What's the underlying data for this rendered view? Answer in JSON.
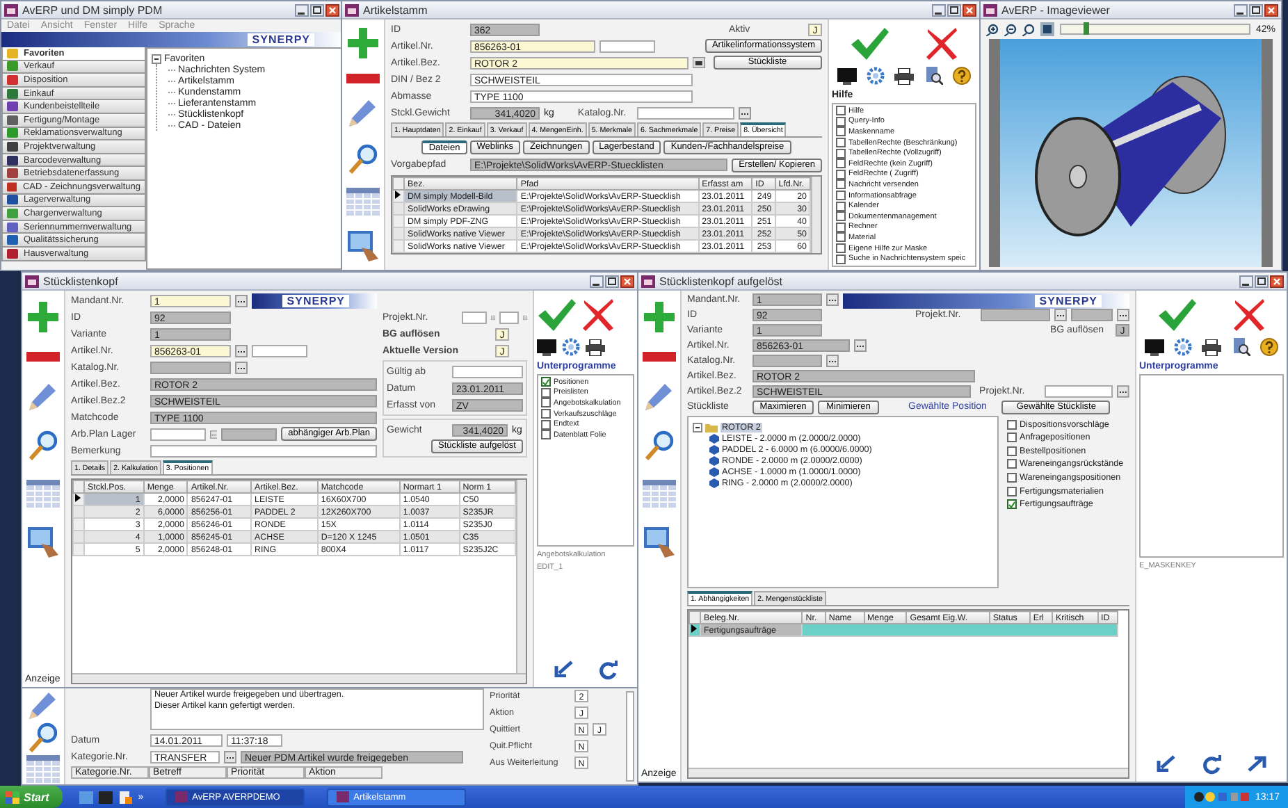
{
  "main_window": {
    "title": "AvERP und DM simply PDM",
    "menu": [
      "Datei",
      "Ansicht",
      "Fenster",
      "Hilfe",
      "Sprache"
    ],
    "logo": "SYNERPY",
    "nav_items": [
      {
        "label": "Favoriten",
        "selected": true
      },
      {
        "label": "Verkauf",
        "selected": false
      },
      {
        "label": "Disposition",
        "selected": false
      },
      {
        "label": "Einkauf",
        "selected": false
      },
      {
        "label": "Kundenbeistellteile",
        "selected": false
      },
      {
        "label": "Fertigung/Montage",
        "selected": false
      },
      {
        "label": "Reklamationsverwaltung",
        "selected": false
      },
      {
        "label": "Projektverwaltung",
        "selected": false
      },
      {
        "label": "Barcodeverwaltung",
        "selected": false
      },
      {
        "label": "Betriebsdatenerfassung",
        "selected": false
      },
      {
        "label": "CAD - Zeichnungsverwaltung",
        "selected": false
      },
      {
        "label": "Lagerverwaltung",
        "selected": false
      },
      {
        "label": "Chargenverwaltung",
        "selected": false
      },
      {
        "label": "Seriennummernverwaltung",
        "selected": false
      },
      {
        "label": "Qualitätssicherung",
        "selected": false
      },
      {
        "label": "Hausverwaltung",
        "selected": false
      }
    ],
    "tree": {
      "label": "Favoriten",
      "expanded": true,
      "children": [
        {
          "label": "Nachrichten System"
        },
        {
          "label": "Artikelstamm"
        },
        {
          "label": "Kundenstamm"
        },
        {
          "label": "Lieferantenstamm"
        },
        {
          "label": "Stücklistenkopf"
        },
        {
          "label": "CAD - Dateien"
        }
      ]
    }
  },
  "article_window": {
    "title": "Artikelstamm",
    "fields": [
      {
        "label": "ID",
        "value": "362",
        "kind": "readonly"
      },
      {
        "label": "Artikel.Nr.",
        "value": "856263-01",
        "kind": "required"
      },
      {
        "label": "Artikel.Bez.",
        "value": "ROTOR 2",
        "kind": "required"
      },
      {
        "label": "DIN / Bez 2",
        "value": "SCHWEISTEIL",
        "kind": "edit"
      },
      {
        "label": "Abmasse",
        "value": "TYPE 1100",
        "kind": "edit"
      },
      {
        "label": "Stckl.Gewicht",
        "value": "341,4020",
        "kind": "readonly"
      }
    ],
    "weight_unit": "kg",
    "catalog_label": "Katalog.Nr.",
    "active": {
      "label": "Aktiv",
      "value": "J"
    },
    "buttons": [
      "Artikelinformationssystem",
      "Stückliste"
    ],
    "tabs": [
      {
        "label": "1. Hauptdaten",
        "selected": false
      },
      {
        "label": "2. Einkauf",
        "selected": false
      },
      {
        "label": "3. Verkauf",
        "selected": false
      },
      {
        "label": "4. MengenEinh.",
        "selected": false
      },
      {
        "label": "5. Merkmale",
        "selected": false
      },
      {
        "label": "6. Sachmerkmale",
        "selected": false
      },
      {
        "label": "7. Preise",
        "selected": false
      },
      {
        "label": "8. Übersicht",
        "selected": true
      }
    ],
    "subtabs": [
      {
        "label": "Dateien",
        "selected": true
      },
      {
        "label": "Weblinks",
        "selected": false
      },
      {
        "label": "Zeichnungen",
        "selected": false
      },
      {
        "label": "Lagerbestand",
        "selected": false
      },
      {
        "label": "Kunden-/Fachhandelspreise",
        "selected": false
      }
    ],
    "default_path": {
      "label": "Vorgabepfad",
      "value": "E:\\Projekte\\SolidWorks\\AvERP-Stuecklisten",
      "button": "Erstellen/ Kopieren"
    },
    "table": {
      "columns": [
        "Bez.",
        "Pfad",
        "Erfasst am",
        "ID",
        "Lfd.Nr."
      ],
      "rows": [
        {
          "cells": [
            "DM simply Modell-Bild",
            "E:\\Projekte\\SolidWorks\\AvERP-Stuecklish",
            "23.01.2011",
            "249",
            "20"
          ],
          "selected": true
        },
        {
          "cells": [
            "SolidWorks eDrawing",
            "E:\\Projekte\\SolidWorks\\AvERP-Stuecklish",
            "23.01.2011",
            "250",
            "30"
          ],
          "selected": false
        },
        {
          "cells": [
            "DM simply PDF-ZNG",
            "E:\\Projekte\\SolidWorks\\AvERP-Stuecklish",
            "23.01.2011",
            "251",
            "40"
          ],
          "selected": false
        },
        {
          "cells": [
            "SolidWorks native Viewer",
            "E:\\Projekte\\SolidWorks\\AvERP-Stuecklish",
            "23.01.2011",
            "252",
            "50"
          ],
          "selected": false
        },
        {
          "cells": [
            "SolidWorks native Viewer",
            "E:\\Projekte\\SolidWorks\\AvERP-Stuecklish",
            "23.01.2011",
            "253",
            "60"
          ],
          "selected": false
        }
      ]
    },
    "help": {
      "title": "Hilfe",
      "items": [
        {
          "label": "Hilfe",
          "checked": false
        },
        {
          "label": "Query-Info",
          "checked": false
        },
        {
          "label": "Maskenname",
          "checked": false
        },
        {
          "label": "TabellenRechte (Beschränkung)",
          "checked": false
        },
        {
          "label": "TabellenRechte (Vollzugriff)",
          "checked": false
        },
        {
          "label": "FeldRechte (kein Zugriff)",
          "checked": false
        },
        {
          "label": "FeldRechte ( Zugriff)",
          "checked": false
        },
        {
          "label": "Nachricht versenden",
          "checked": false
        },
        {
          "label": "Informationsabfrage",
          "checked": false
        },
        {
          "label": "Kalender",
          "checked": false
        },
        {
          "label": "Dokumentenmanagement",
          "checked": false
        },
        {
          "label": "Rechner",
          "checked": false
        },
        {
          "label": "Material",
          "checked": false
        },
        {
          "label": "Eigene Hilfe zur Maske",
          "checked": false
        },
        {
          "label": "Suche in Nachrichtensystem speic",
          "checked": false
        }
      ]
    }
  },
  "image_viewer": {
    "title": "AvERP - Imageviewer",
    "zoom": {
      "level": 0.12,
      "reading": "42%"
    }
  },
  "bom_window": {
    "title": "Stücklistenkopf",
    "logo": "SYNERPY",
    "fields": [
      {
        "label": "Mandant.Nr.",
        "value": "1",
        "kind": "required",
        "lookup": true
      },
      {
        "label": "ID",
        "value": "92",
        "kind": "readonly",
        "lookup": false
      },
      {
        "label": "Variante",
        "value": "1",
        "kind": "readonly",
        "lookup": false
      },
      {
        "label": "Artikel.Nr.",
        "value": "856263-01",
        "kind": "required",
        "lookup": true
      },
      {
        "label": "Katalog.Nr.",
        "kind": "readonly",
        "lookup": true
      },
      {
        "label": "Artikel.Bez.",
        "value": "ROTOR 2",
        "kind": "readonly",
        "lookup": false
      },
      {
        "label": "Artikel.Bez.2",
        "value": "SCHWEISTEIL",
        "kind": "readonly",
        "lookup": false
      },
      {
        "label": "Matchcode",
        "value": "TYPE 1100",
        "kind": "readonly",
        "lookup": false
      },
      {
        "label": "Arb.Plan Lager",
        "kind": "edit",
        "lookup": true
      },
      {
        "label": "Bemerkung",
        "kind": "edit",
        "lookup": false
      }
    ],
    "plan_button": "abhängiger Arb.Plan",
    "project_label": "Projekt.Nr.",
    "flags": [
      {
        "label": "BG auflösen",
        "value": "J"
      },
      {
        "label": "Aktuelle Version",
        "value": "J"
      }
    ],
    "validity": [
      {
        "label": "Gültig ab",
        "kind": "edit"
      },
      {
        "label": "Datum",
        "value": "23.01.2011",
        "kind": "readonly"
      },
      {
        "label": "Erfasst von",
        "value": "ZV",
        "kind": "readonly"
      }
    ],
    "weight": {
      "label": "Gewicht",
      "value": "341,4020",
      "unit": "kg"
    },
    "resolve_button": "Stückliste aufgelöst",
    "tabs": [
      {
        "label": "1. Details",
        "selected": false
      },
      {
        "label": "2. Kalkulation",
        "selected": false
      },
      {
        "label": "3. Positionen",
        "selected": true
      }
    ],
    "table": {
      "columns": [
        "Stckl.Pos.",
        "Menge",
        "Artikel.Nr.",
        "Artikel.Bez.",
        "Matchcode",
        "Normart 1",
        "Norm 1"
      ],
      "rows": [
        {
          "cells": [
            "1",
            "2,0000",
            "856247-01",
            "LEISTE",
            "16X60X700",
            "1.0540",
            "C50"
          ],
          "selected": true
        },
        {
          "cells": [
            "2",
            "6,0000",
            "856256-01",
            "PADDEL 2",
            "12X260X700",
            "1.0037",
            "S235JR"
          ],
          "selected": false
        },
        {
          "cells": [
            "3",
            "2,0000",
            "856246-01",
            "RONDE",
            "15X",
            "1.0114",
            "S235J0"
          ],
          "selected": false
        },
        {
          "cells": [
            "4",
            "1,0000",
            "856245-01",
            "ACHSE",
            "D=120 X 1245",
            "1.0501",
            "C35"
          ],
          "selected": false
        },
        {
          "cells": [
            "5",
            "2,0000",
            "856248-01",
            "RING",
            "800X4",
            "1.0117",
            "S235J2C"
          ],
          "selected": false
        }
      ]
    },
    "display_label": "Anzeige",
    "subprograms": {
      "title": "Unterprogramme",
      "items": [
        {
          "label": "Positionen",
          "checked": true
        },
        {
          "label": "Preislisten",
          "checked": false
        },
        {
          "label": "Angebotskalkulation",
          "checked": false
        },
        {
          "label": "Verkaufszuschläge",
          "checked": false
        },
        {
          "label": "Endtext",
          "checked": false
        },
        {
          "label": "Datenblatt Folie",
          "checked": false
        }
      ],
      "caption": "Angebotskalkulation",
      "edit_name": "EDIT_1"
    }
  },
  "resolved_bom_window": {
    "title": "Stücklistenkopf aufgelöst",
    "logo": "SYNERPY",
    "fields": [
      {
        "label": "Mandant.Nr.",
        "value": "1",
        "lookup": true
      },
      {
        "label": "ID",
        "value": "92",
        "lookup": false
      },
      {
        "label": "Variante",
        "value": "1",
        "lookup": false
      },
      {
        "label": "Artikel.Nr.",
        "value": "856263-01",
        "lookup": true
      },
      {
        "label": "Katalog.Nr.",
        "lookup": true
      },
      {
        "label": "Artikel.Bez.",
        "value": "ROTOR 2",
        "lookup": false
      },
      {
        "label": "Artikel.Bez.2",
        "value": "SCHWEISTEIL",
        "lookup": false
      }
    ],
    "project_label": "Projekt.Nr.",
    "flag": {
      "label": "BG auflösen",
      "value": "J"
    },
    "project_label_2": "Projekt.Nr.",
    "bom_label": "Stückliste",
    "buttons": [
      "Maximieren",
      "Minimieren"
    ],
    "position_label": "Gewählte Position",
    "bom_button": "Gewählte Stückliste",
    "tree": {
      "label": "ROTOR 2",
      "expanded": true,
      "selected": true,
      "children": [
        {
          "label": "LEISTE - 2.0000 m (2.0000/2.0000)",
          "selected": false
        },
        {
          "label": "PADDEL 2 - 6.0000 m (6.0000/6.0000)",
          "selected": false
        },
        {
          "label": "RONDE - 2.0000 m (2.0000/2.0000)",
          "selected": false
        },
        {
          "label": "ACHSE - 1.0000 m (1.0000/1.0000)",
          "selected": false
        },
        {
          "label": "RING - 2.0000 m (2.0000/2.0000)",
          "selected": false
        }
      ]
    },
    "options": [
      {
        "label": "Dispositionsvorschläge",
        "checked": false
      },
      {
        "label": "Anfragepositionen",
        "checked": false
      },
      {
        "label": "Bestellpositionen",
        "checked": false
      },
      {
        "label": "Wareneingangsrückstände",
        "checked": false
      },
      {
        "label": "Wareneingangspositionen",
        "checked": false
      },
      {
        "label": "Fertigungsmaterialien",
        "checked": false
      },
      {
        "label": "Fertigungsaufträge",
        "checked": true
      }
    ],
    "tabs": [
      {
        "label": "1. Abhängigkeiten",
        "selected": true
      },
      {
        "label": "2. Mengenstückliste",
        "selected": false
      }
    ],
    "table": {
      "columns": [
        "Beleg.Nr.",
        "Nr.",
        "Name",
        "Menge",
        "Gesamt Eig.W.",
        "Status",
        "Erl",
        "Kritisch",
        "ID"
      ],
      "group_row": "Fertigungsaufträge"
    },
    "subprograms_title": "Unterprogramme",
    "mask_key": "E_MASKENKEY",
    "display_label": "Anzeige"
  },
  "message_window": {
    "text": "Neuer Artikel wurde freigegeben und übertragen.\nDieser Artikel kann gefertigt werden.",
    "date": {
      "label": "Datum",
      "value": "14.01.2011",
      "time": "11:37:18"
    },
    "category": {
      "label": "Kategorie.Nr.",
      "value": "TRANSFER",
      "description": "Neuer PDM Artikel wurde freigegeben"
    },
    "flags": [
      {
        "label": "Priorität",
        "values": [
          "2"
        ]
      },
      {
        "label": "Aktion",
        "values": [
          "J"
        ]
      },
      {
        "label": "Quittiert",
        "values": [
          "N",
          "J"
        ]
      },
      {
        "label": "Quit.Pflicht",
        "values": [
          "N"
        ]
      },
      {
        "label": "Aus Weiterleitung",
        "values": [
          "N"
        ]
      }
    ],
    "columns": [
      "Kategorie.Nr.",
      "Betreff",
      "Priorität",
      "Aktion"
    ]
  },
  "taskbar": {
    "start": "Start",
    "more": "»",
    "tasks": [
      {
        "label": "AvERP AVERPDEMO",
        "selected": true
      },
      {
        "label": "Artikelstamm",
        "selected": false
      }
    ],
    "clock": "13:17"
  }
}
